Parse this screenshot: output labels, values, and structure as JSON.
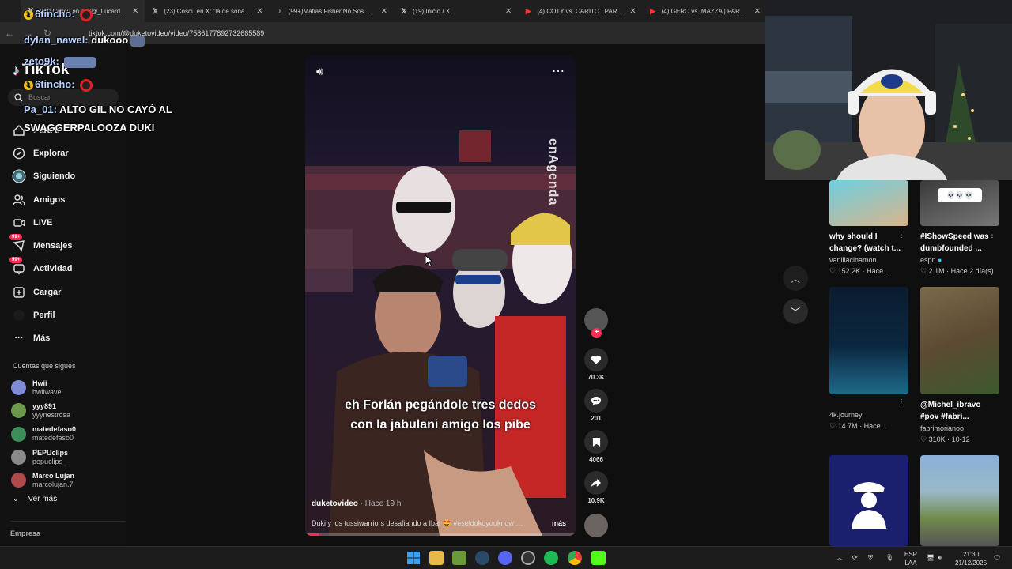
{
  "browser": {
    "tabs": [
      {
        "title": "(23) Coscu en X: \"@_Lucardo_ \"",
        "icon": "x-icon"
      },
      {
        "title": "(23) Coscu en X: \"la de sonar más\"",
        "icon": "x-icon"
      },
      {
        "title": "(99+)Matias Fisher No Sos Und…",
        "icon": "tiktok-icon"
      },
      {
        "title": "(19) Inicio / X",
        "icon": "x-icon"
      },
      {
        "title": "(4) COTY vs. CARITO | PARENSE…",
        "icon": "youtube-icon"
      },
      {
        "title": "(4) GERO vs. MAZZA | PARENSE…",
        "icon": "youtube-icon"
      }
    ],
    "url": "tiktok.com/@duketovideo/video/7586177892732685589"
  },
  "chat": [
    {
      "user": "dylan_nawel:",
      "msg": "dukooo"
    },
    {
      "user": "zeto9k:",
      "msg": ""
    },
    {
      "user": "6tincho:",
      "msg": ""
    },
    {
      "user": "Pa_01:",
      "msg": "ALTO GIL NO CAYÓ AL SWAGGERPALOOZA DUKI"
    }
  ],
  "sidebar": {
    "logo": "TikTok",
    "search_placeholder": "Buscar",
    "nav": [
      {
        "label": "Para ti",
        "icon": "home-icon"
      },
      {
        "label": "Explorar",
        "icon": "compass-icon"
      },
      {
        "label": "Siguiendo",
        "icon": "following-icon"
      },
      {
        "label": "Amigos",
        "icon": "friends-icon"
      },
      {
        "label": "LIVE",
        "icon": "live-icon"
      },
      {
        "label": "Mensajes",
        "icon": "messages-icon",
        "badge": "99+"
      },
      {
        "label": "Actividad",
        "icon": "activity-icon",
        "badge": "99+"
      },
      {
        "label": "Cargar",
        "icon": "upload-icon"
      },
      {
        "label": "Perfil",
        "icon": "profile-icon"
      },
      {
        "label": "Más",
        "icon": "more-icon"
      }
    ],
    "following_title": "Cuentas que sigues",
    "accounts": [
      {
        "name": "Hwii",
        "user": "hwiiwave",
        "color": "#7f8bd6"
      },
      {
        "name": "yyy891",
        "user": "yyynestrosa",
        "color": "#6a9a4a"
      },
      {
        "name": "matedefaso0",
        "user": "matedefaso0",
        "color": "#3d8f5a"
      },
      {
        "name": "PEPUclips",
        "user": "pepuclips_",
        "color": "#8a8a8a"
      },
      {
        "name": "Marco Lujan",
        "user": "marcolujan.7",
        "color": "#b04a4a"
      }
    ],
    "see_more": "Ver más",
    "company": "Empresa"
  },
  "video": {
    "watermark": "enAgenda",
    "caption": "eh Forlán pegándole tres dedos\ncon la jabulani amigo los pibe",
    "author": "duketovideo",
    "time": " · Hace 19 h",
    "description": "Duki y los tussiwarriors desafiando a Ibai 🤩 #eseldukoyouknow …",
    "more": "más",
    "progress": 0.05
  },
  "actions": {
    "likes": "70.3K",
    "comments": "201",
    "saves": "4066",
    "shares": "10.9K"
  },
  "grid": [
    {
      "title": "why should I change? (watch t...",
      "user": "vanillacinamon",
      "stats": "♡ 152.2K · Hace...",
      "colors": [
        "#6fcfe0",
        "#d8b48a"
      ]
    },
    {
      "title": "#IShowSpeed was dumbfounded ...",
      "user": "espn",
      "stats": "♡ 2.1M · Hace 2 día(s)",
      "colors": [
        "#3a3a3a",
        "#777"
      ]
    },
    {
      "title": "",
      "user": "4k.journey",
      "stats": "♡ 14.7M · Hace...",
      "colors": [
        "#0b2740",
        "#1e6a8a"
      ]
    },
    {
      "title": "@Michel_ibravo #pov #fabri...",
      "user": "fabrimorianoo",
      "stats": "♡ 310K · 10-12",
      "colors": [
        "#5c4a32",
        "#3d5a2e"
      ]
    },
    {
      "title": "",
      "user": "",
      "stats": "",
      "colors": [
        "#1a1f6e",
        "#2a2f8e"
      ]
    },
    {
      "title": "",
      "user": "",
      "stats": "",
      "colors": [
        "#8ab0d8",
        "#6f8a4a"
      ]
    }
  ],
  "taskbar": {
    "lang1": "ESP",
    "lang2": "LAA",
    "time": "21:30",
    "date": "21/12/2025"
  }
}
